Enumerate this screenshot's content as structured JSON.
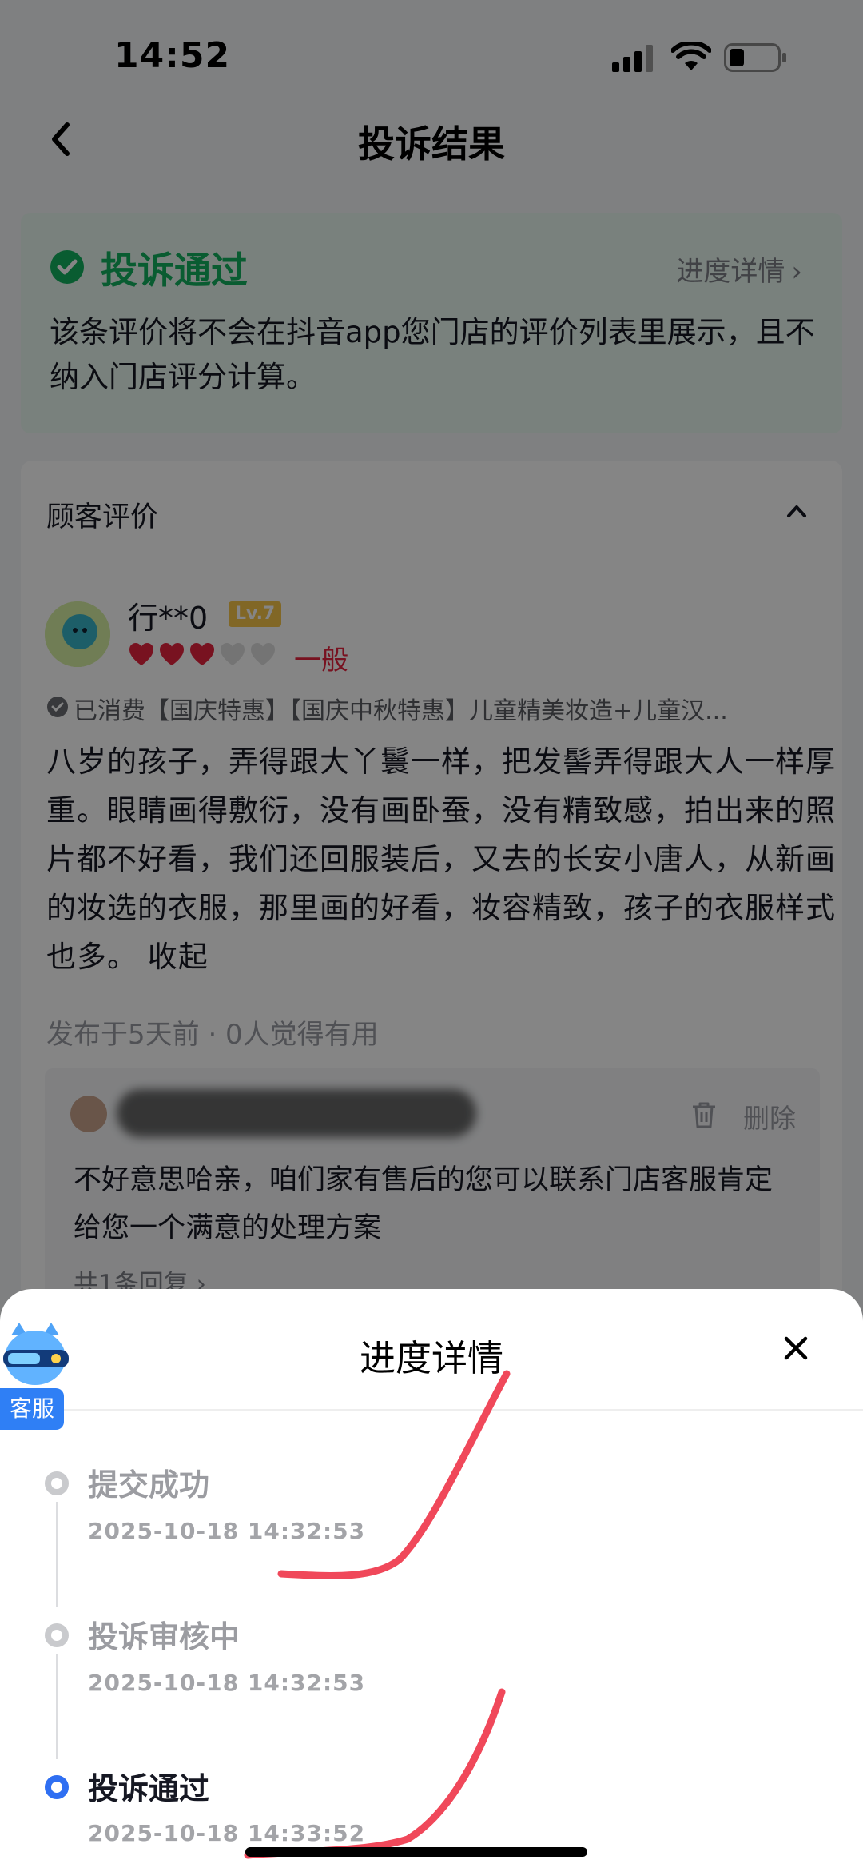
{
  "status_bar": {
    "time": "14:52"
  },
  "nav": {
    "title": "投诉结果"
  },
  "result": {
    "status": "投诉通过",
    "progress_link": "进度详情",
    "description": "该条评价将不会在抖音app您门店的评价列表里展示，且不纳入门店评分计算。"
  },
  "review": {
    "section_title": "顾客评价",
    "username": "行**0",
    "level": "Lv.7",
    "hearts_filled": 3,
    "hearts_total": 5,
    "rating_text": "一般",
    "purchase": "已消费【国庆特惠】【国庆中秋特惠】儿童精美妆造+儿童汉...",
    "content": "八岁的孩子，弄得跟大丫鬟一样，把发髻弄得跟大人一样厚重。眼睛画得敷衍，没有画卧蚕，没有精致感，拍出来的照片都不好看，我们还回服装后，又去的长安小唐人，从新画的妆选的衣服，那里画的好看，妆容精致，孩子的衣服样式也多。",
    "collapse_label": "收起",
    "meta": "发布于5天前 · 0人觉得有用",
    "reply": {
      "delete_label": "删除",
      "text": "不好意思哈亲，咱们家有售后的您可以联系门店客服肯定给您一个满意的处理方案",
      "count_label": "共1条回复"
    }
  },
  "sheet": {
    "title": "进度详情",
    "service_label": "客服",
    "steps": [
      {
        "label": "提交成功",
        "time": "2025-10-18 14:32:53",
        "state": "done"
      },
      {
        "label": "投诉审核中",
        "time": "2025-10-18 14:32:53",
        "state": "done"
      },
      {
        "label": "投诉通过",
        "time": "2025-10-18 14:33:52",
        "state": "current"
      }
    ]
  },
  "colors": {
    "success_green": "#12b05f",
    "rating_red": "#e6243f",
    "accent_blue": "#2f6ff2",
    "scribble_red": "#f0485a"
  }
}
